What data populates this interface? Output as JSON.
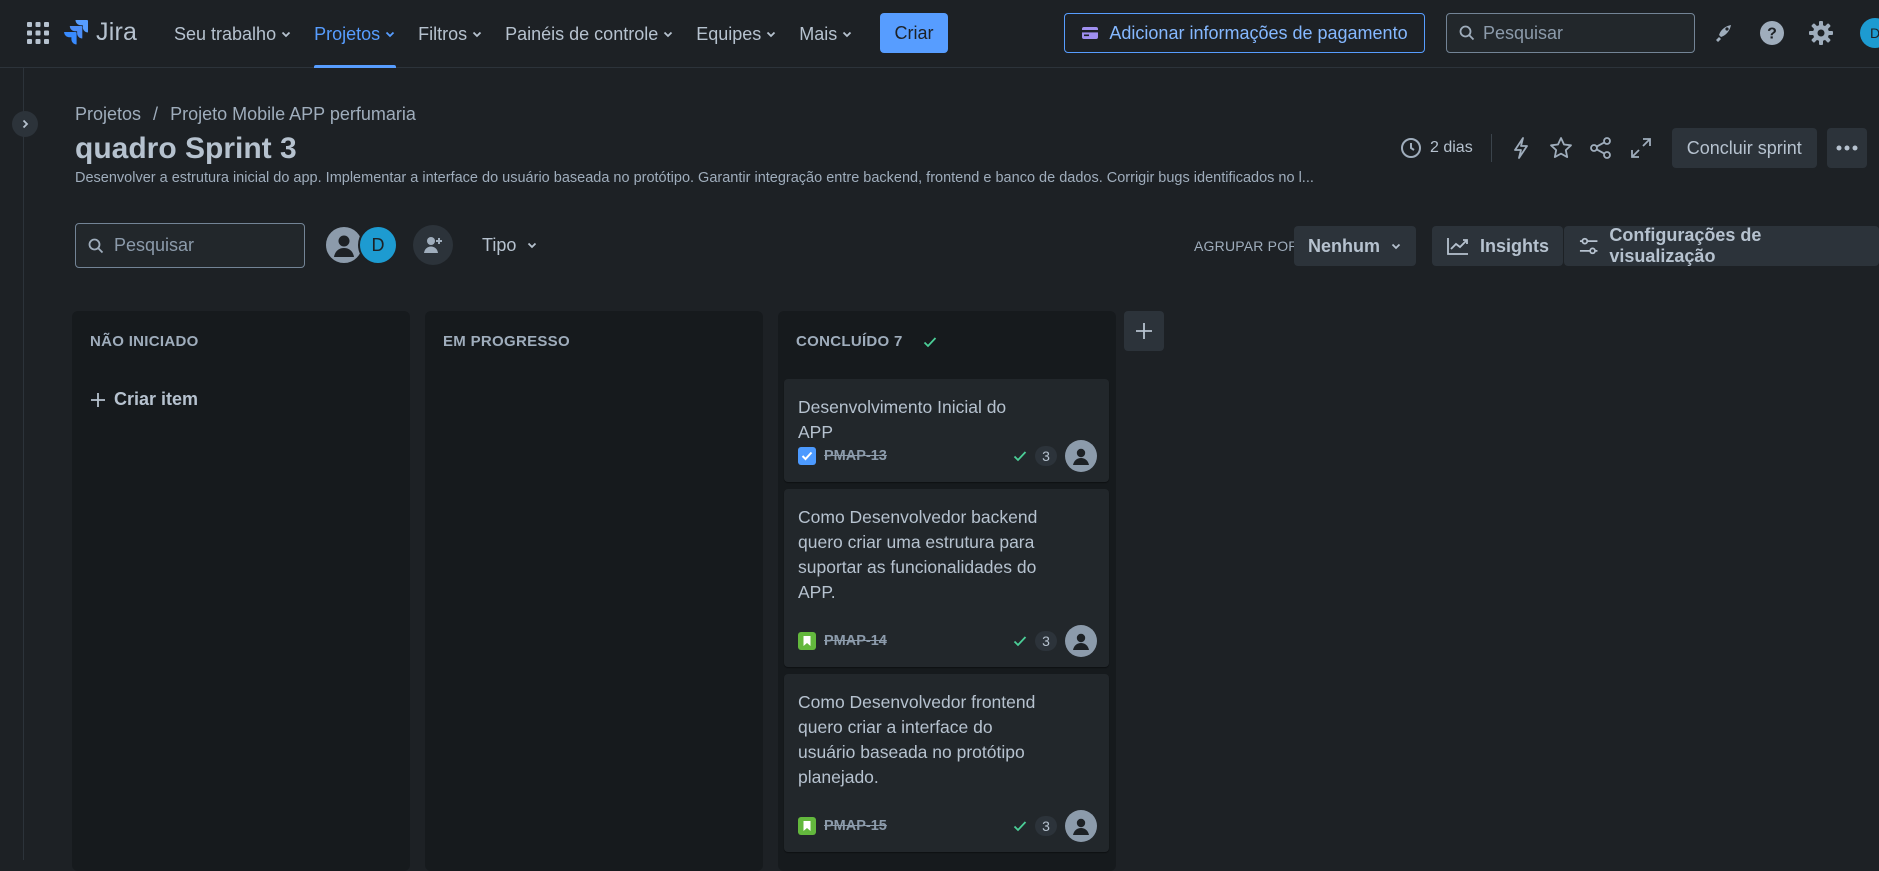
{
  "topnav": {
    "logo": "Jira",
    "items": [
      {
        "label": "Seu trabalho"
      },
      {
        "label": "Projetos"
      },
      {
        "label": "Filtros"
      },
      {
        "label": "Painéis de controle"
      },
      {
        "label": "Equipes"
      },
      {
        "label": "Mais"
      }
    ],
    "active_item": "Projetos",
    "create_label": "Criar",
    "payment_label": "Adicionar informações de pagamento",
    "search_placeholder": "Pesquisar",
    "avatar_initial": "D",
    "icons": [
      "app-switcher-icon",
      "notifications-icon",
      "help-icon",
      "settings-icon"
    ]
  },
  "breadcrumb": {
    "root": "Projetos",
    "separator": "/",
    "project": "Projeto Mobile APP perfumaria"
  },
  "header": {
    "title": "quadro Sprint 3",
    "description": "Desenvolver a estrutura inicial do app. Implementar a interface do usuário baseada no protótipo. Garantir integração entre backend, frontend e banco de dados. Corrigir bugs identificados no l...",
    "time_remaining": "2 dias",
    "complete_sprint_label": "Concluir sprint"
  },
  "toolbar": {
    "search_placeholder": "Pesquisar",
    "avatar_initial": "D",
    "type_label": "Tipo",
    "group_by_label": "AGRUPAR POR",
    "group_by_value": "Nenhum",
    "insights_label": "Insights",
    "view_settings_label": "Configurações de visualização"
  },
  "columns": [
    {
      "title": "NÃO INICIADO",
      "create_label": "Criar item"
    },
    {
      "title": "EM PROGRESSO"
    },
    {
      "title": "CONCLUÍDO 7"
    }
  ],
  "cards": [
    {
      "title": "Desenvolvimento Inicial do APP",
      "key": "PMAP-13",
      "type": "task",
      "estimate": "3"
    },
    {
      "title": "Como Desenvolvedor backend quero criar uma estrutura para suportar as funcionalidades do APP.",
      "key": "PMAP-14",
      "type": "story",
      "estimate": "3"
    },
    {
      "title": "Como Desenvolvedor frontend quero criar a interface do usuário baseada no protótipo planejado.",
      "key": "PMAP-15",
      "type": "story",
      "estimate": "3"
    }
  ],
  "colors": {
    "background": "#1d2125",
    "accent": "#579dff",
    "column": "#161a1d",
    "card": "#22272b",
    "done_check": "#4bce97",
    "story_icon": "#63b83d",
    "task_icon": "#4c9aff"
  }
}
